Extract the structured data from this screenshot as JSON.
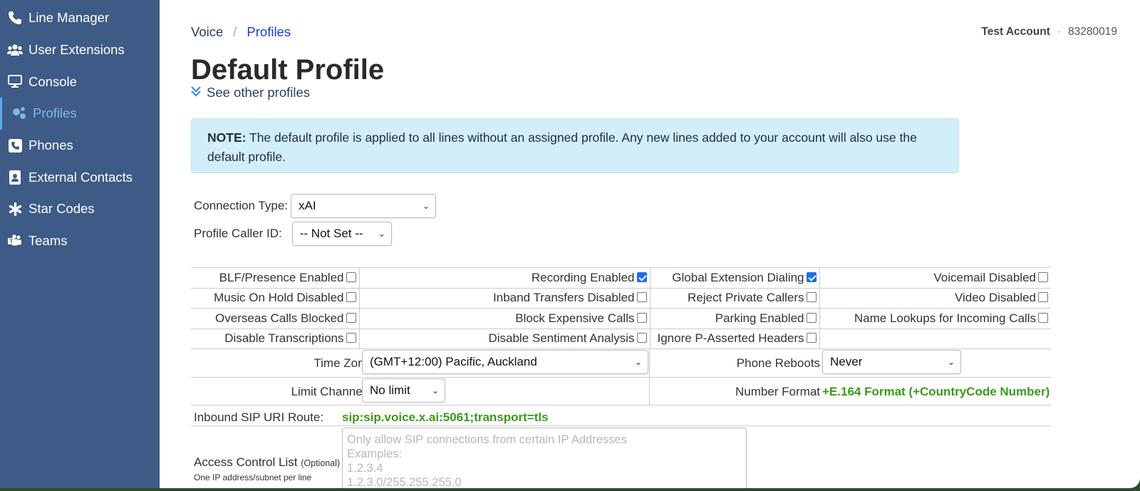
{
  "sidebar": {
    "items": [
      {
        "label": "Line Manager",
        "icon": "phone-icon"
      },
      {
        "label": "User Extensions",
        "icon": "users-icon"
      },
      {
        "label": "Console",
        "icon": "monitor-icon"
      },
      {
        "label": "Profiles",
        "icon": "gears-icon",
        "active": true
      },
      {
        "label": "Phones",
        "icon": "phone-square-icon"
      },
      {
        "label": "External Contacts",
        "icon": "contact-book-icon"
      },
      {
        "label": "Star Codes",
        "icon": "asterisk-icon"
      },
      {
        "label": "Teams",
        "icon": "teams-icon"
      }
    ]
  },
  "breadcrumb": {
    "root": "Voice",
    "sep": "/",
    "current": "Profiles"
  },
  "account": {
    "name": "Test Account",
    "sep": "·",
    "number": "83280019"
  },
  "page": {
    "title": "Default Profile",
    "see_other": "See other profiles"
  },
  "note": {
    "label": "NOTE:",
    "text": " The default profile is applied to all lines without an assigned profile. Any new lines added to your account will also use the default profile."
  },
  "connection_type": {
    "label": "Connection Type:",
    "value": "xAI"
  },
  "caller_id": {
    "label": "Profile Caller ID:",
    "value": "-- Not Set --"
  },
  "options": [
    [
      {
        "label": "BLF/Presence Enabled",
        "checked": false
      },
      {
        "label": "Recording Enabled",
        "checked": true
      },
      {
        "label": "Global Extension Dialing",
        "checked": true
      },
      {
        "label": "Voicemail Disabled",
        "checked": false
      }
    ],
    [
      {
        "label": "Music On Hold Disabled",
        "checked": false
      },
      {
        "label": "Inband Transfers Disabled",
        "checked": false
      },
      {
        "label": "Reject Private Callers",
        "checked": false
      },
      {
        "label": "Video Disabled",
        "checked": false
      }
    ],
    [
      {
        "label": "Overseas Calls Blocked",
        "checked": false
      },
      {
        "label": "Block Expensive Calls",
        "checked": false
      },
      {
        "label": "Parking Enabled",
        "checked": false
      },
      {
        "label": "Name Lookups for Incoming Calls",
        "checked": false
      }
    ],
    [
      {
        "label": "Disable Transcriptions",
        "checked": false
      },
      {
        "label": "Disable Sentiment Analysis",
        "checked": false
      },
      {
        "label": "Ignore P-Asserted Headers",
        "checked": false
      }
    ]
  ],
  "time_zone": {
    "label": "Time Zone",
    "value": "(GMT+12:00) Pacific, Auckland"
  },
  "phone_reboots": {
    "label": "Phone Reboots",
    "value": "Never"
  },
  "limit_channels": {
    "label": "Limit Channels",
    "value": "No limit"
  },
  "number_format": {
    "label": "Number Format",
    "value": "+E.164 Format (+CountryCode Number)"
  },
  "sip_route": {
    "label": "Inbound SIP URI Route:",
    "value": "sip:sip.voice.x.ai:5061;transport=tls"
  },
  "acl": {
    "label": "Access Control List",
    "optional": "(Optional)",
    "hint": "One IP address/subnet per line",
    "placeholder_lines": [
      "Only allow SIP connections from certain IP Addresses",
      "Examples:",
      "1.2.3.4",
      "1.2.3.0/255.255.255.0"
    ]
  }
}
